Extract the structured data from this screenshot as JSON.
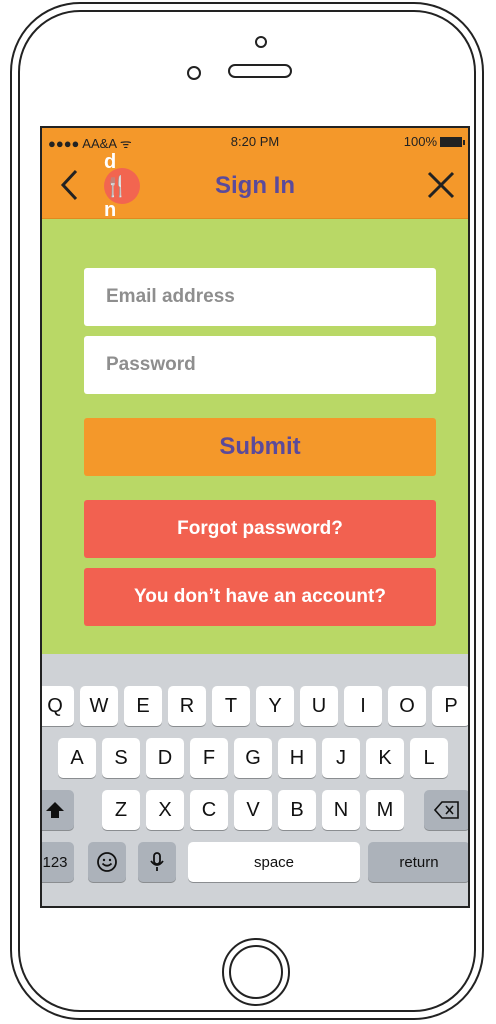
{
  "status_bar": {
    "carrier": "●●●● AA&A ᯤ",
    "time": "8:20 PM",
    "battery": "100%"
  },
  "nav": {
    "logo_text": "d🍴n",
    "title": "Sign In"
  },
  "form": {
    "email_placeholder": "Email address",
    "email_value": "",
    "password_placeholder": "Password",
    "password_value": "",
    "submit_label": "Submit",
    "forgot_label": "Forgot password?",
    "no_account_label": "You don’t have an account?"
  },
  "keyboard": {
    "row1": [
      "Q",
      "W",
      "E",
      "R",
      "T",
      "Y",
      "U",
      "I",
      "O",
      "P"
    ],
    "row2": [
      "A",
      "S",
      "D",
      "F",
      "G",
      "H",
      "J",
      "K",
      "L"
    ],
    "row3": [
      "Z",
      "X",
      "C",
      "V",
      "B",
      "N",
      "M"
    ],
    "numbers_label": "123",
    "space_label": "space",
    "return_label": "return",
    "emoji_icon": "smiley-icon",
    "mic_icon": "microphone-icon",
    "shift_icon": "shift-icon",
    "delete_icon": "backspace-icon"
  },
  "colors": {
    "orange": "#f4982a",
    "green": "#b9d866",
    "red": "#f26150",
    "purple": "#5a4a9b"
  }
}
